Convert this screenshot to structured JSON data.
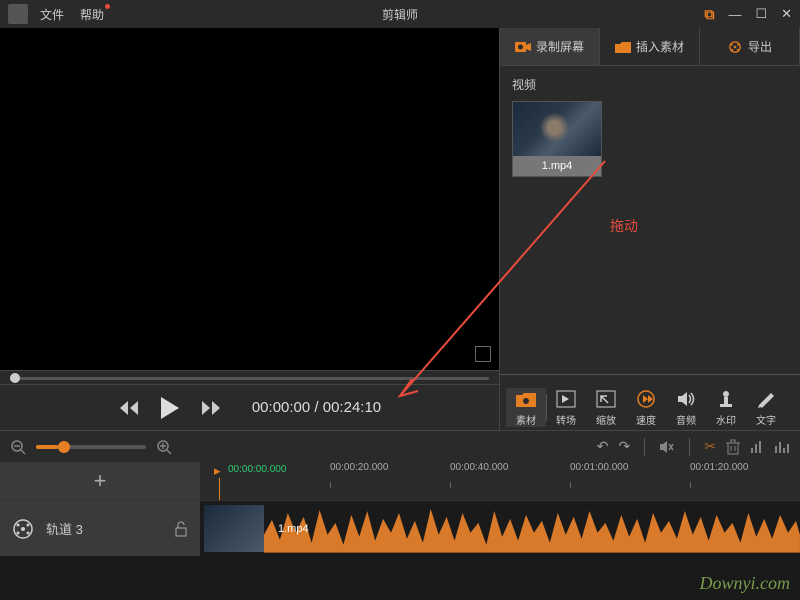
{
  "menu": {
    "file": "文件",
    "help": "帮助"
  },
  "app_title": "剪辑师",
  "side_tabs": {
    "record": "录制屏幕",
    "insert": "插入素材",
    "export": "导出"
  },
  "media": {
    "section": "视频",
    "clip_name": "1.mp4"
  },
  "drag_hint": "拖动",
  "tools": {
    "material": "素材",
    "transition": "转场",
    "zoom": "缩放",
    "speed": "速度",
    "audio": "音频",
    "watermark": "水印",
    "text": "文字"
  },
  "playback": {
    "current": "00:00:00",
    "total": "00:24:10"
  },
  "timeline": {
    "playhead_time": "00:00:00.000",
    "marks": [
      "00:00:20.000",
      "00:00:40.000",
      "00:01:00.000",
      "00:01:20.000"
    ],
    "track_name": "轨道 3",
    "clip_label": "1.mp4"
  },
  "watermark": "Downyi.com",
  "colors": {
    "accent": "#e67e22",
    "alert": "#e74c3c",
    "playhead_time": "#2ecc71"
  }
}
